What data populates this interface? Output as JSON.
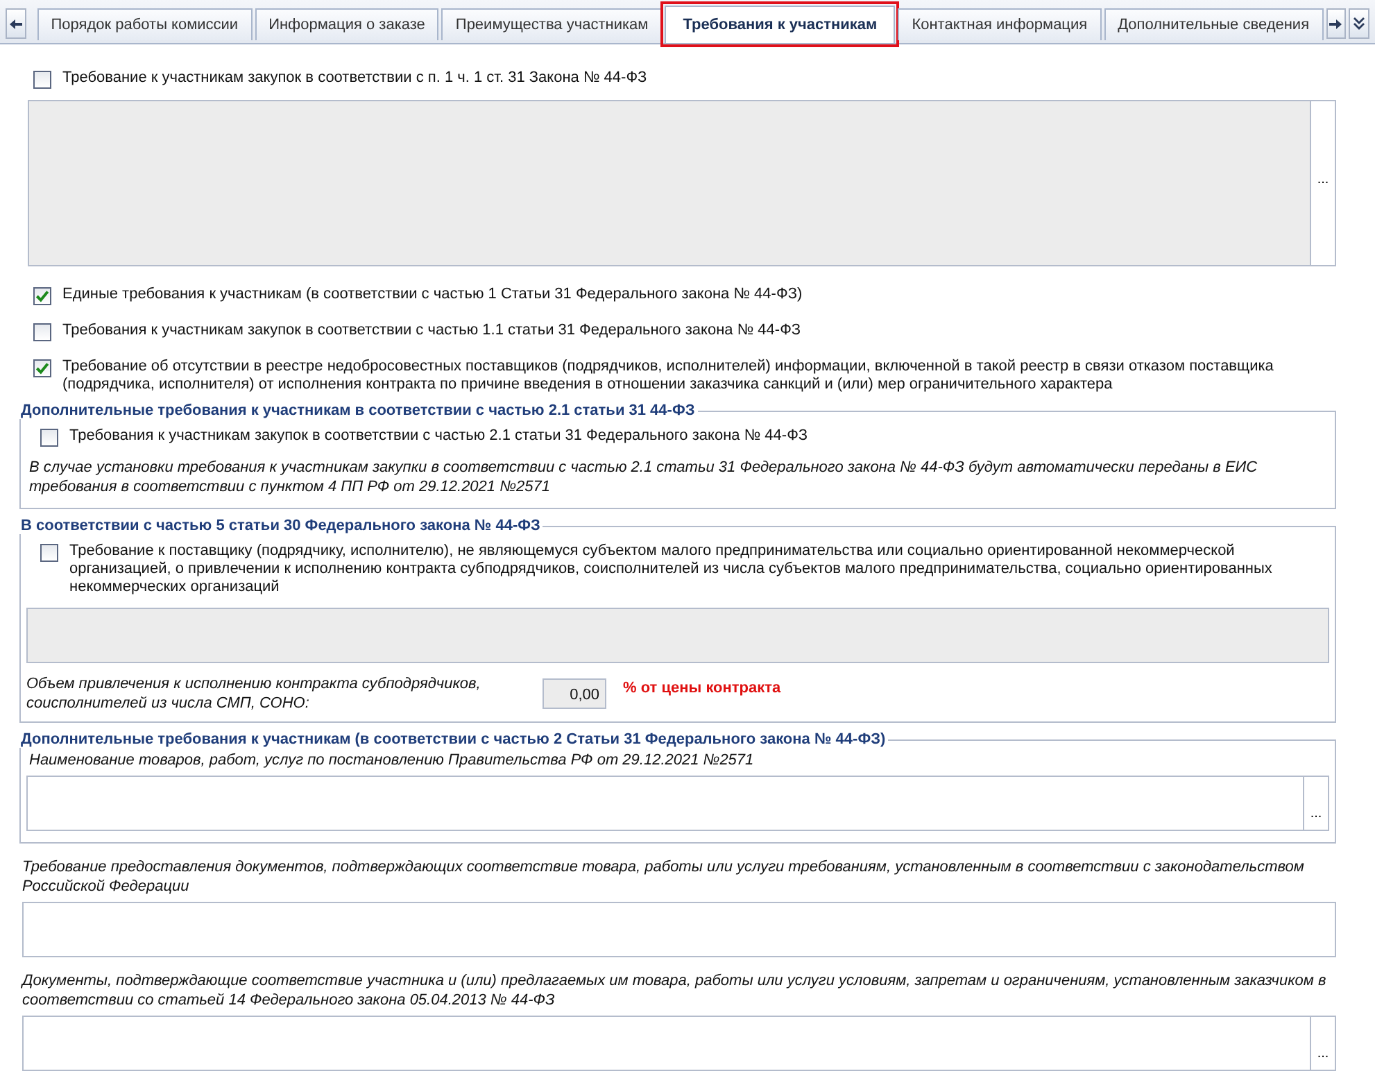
{
  "tabs": [
    {
      "label": "Порядок работы комиссии",
      "selected": false
    },
    {
      "label": "Информация о заказе",
      "selected": false
    },
    {
      "label": "Преимущества участникам",
      "selected": false
    },
    {
      "label": "Требования к участникам",
      "selected": true
    },
    {
      "label": "Контактная информация",
      "selected": false
    },
    {
      "label": "Дополнительные сведения",
      "selected": false
    }
  ],
  "top_requirement": {
    "label": "Требование к участникам закупок в соответствии с п. 1 ч. 1 ст. 31 Закона № 44-ФЗ",
    "checked": false,
    "text_area": {
      "disabled": true,
      "button": "..."
    }
  },
  "requirements": [
    {
      "label": "Единые требования к участникам (в соответствии с частью 1 Статьи 31 Федерального закона № 44-ФЗ)",
      "checked": true
    },
    {
      "label": "Требования к участникам закупок в соответствии с частью 1.1 статьи 31 Федерального закона № 44-ФЗ",
      "checked": false
    },
    {
      "label": "Требование об отсутствии в реестре недобросовестных поставщиков (подрядчиков, исполнителей) информации, включенной в такой реестр в связи отказом поставщика (подрядчика, исполнителя) от исполнения контракта по причине введения в отношении заказчика санкций и (или) мер ограничительного характера",
      "checked": true
    }
  ],
  "group_part_2_1": {
    "legend": "Дополнительные требования к участникам в соответствии с частью 2.1 статьи 31 44-ФЗ",
    "checkbox": {
      "label": "Требования к участникам закупок в соответствии с частью 2.1 статьи 31 Федерального закона № 44-ФЗ",
      "checked": false
    },
    "note": "В случае установки требования к участникам закупки в соответствии с частью 2.1 статьи 31 Федерального закона № 44-ФЗ будут автоматически переданы в ЕИС требования в соответствии с пунктом 4 ПП РФ от 29.12.2021 №2571"
  },
  "group_part_5": {
    "legend": "В соответствии с частью 5 статьи 30 Федерального закона № 44-ФЗ",
    "checkbox": {
      "label": "Требование к поставщику (подрядчику, исполнителю), не являющемуся субъектом малого предпринимательства или социально ориентированной некоммерческой организацией, о привлечении к исполнению контракта субподрядчиков, соисполнителей из числа субъектов малого предпринимательства, социально ориентированных некоммерческих организаций",
      "checked": false
    },
    "text_area": {
      "disabled": true
    },
    "volume_label": "Объем привлечения к исполнению контракта субподрядчиков, соисполнителей из числа СМП, СОНО:",
    "volume_value": "0,00",
    "volume_unit": "% от цены контракта"
  },
  "group_part_2": {
    "legend": "Дополнительные требования к участникам (в соответствии с частью 2 Статьи 31 Федерального закона № 44-ФЗ)",
    "field_label": "Наименование товаров, работ, услуг по постановлению Правительства РФ от 29.12.2021 №2571",
    "field_button": "..."
  },
  "fields": [
    {
      "label": "Требование предоставления документов, подтверждающих соответствие товара, работы или услуги требованиям, установленным в соответствии с законодательством Российской Федерации"
    },
    {
      "label": "Документы, подтверждающие соответствие участника и (или) предлагаемых им товара, работы или услуги условиям, запретам и ограничениям, установленным заказчиком в соответствии со статьей 14 Федерального закона 05.04.2013 № 44-ФЗ",
      "button": "..."
    }
  ]
}
